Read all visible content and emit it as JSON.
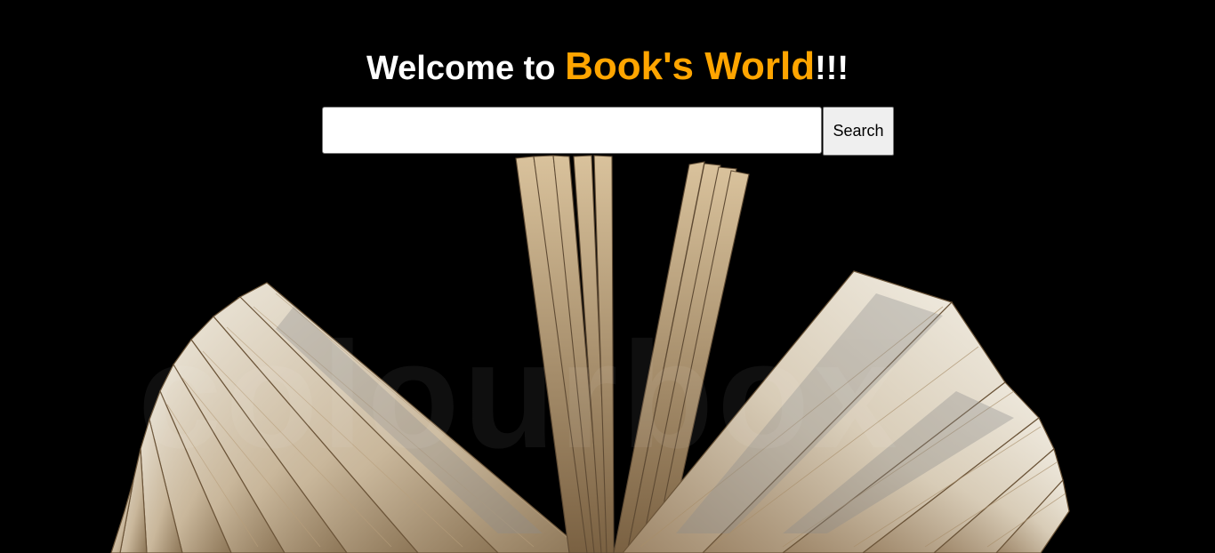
{
  "header": {
    "title_prefix": "Welcome to ",
    "title_brand": "Book's World",
    "title_suffix": "!!!"
  },
  "search": {
    "value": "",
    "placeholder": "",
    "button_label": "Search"
  },
  "background": {
    "watermark_text": "colourbox"
  },
  "colors": {
    "background": "#000000",
    "title": "#ffffff",
    "brand": "#ffa500",
    "button_bg": "#efefef"
  }
}
